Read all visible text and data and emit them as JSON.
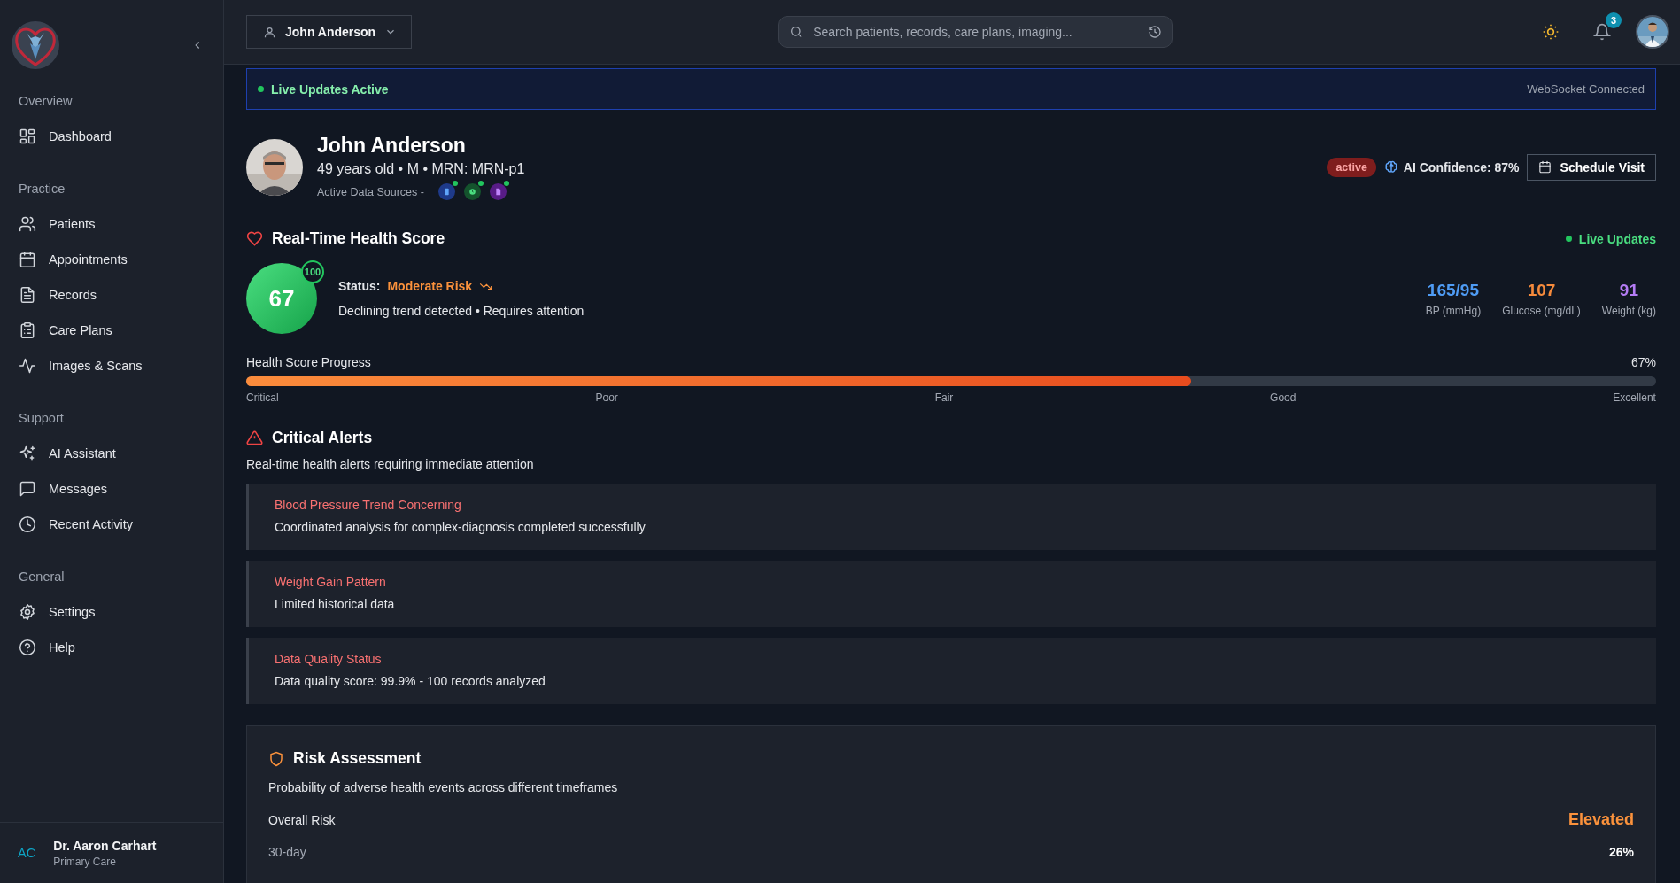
{
  "sidebar": {
    "sections": [
      {
        "title": "Overview",
        "items": [
          {
            "label": "Dashboard",
            "kind": "dashboard"
          }
        ]
      },
      {
        "title": "Practice",
        "items": [
          {
            "label": "Patients",
            "kind": "users"
          },
          {
            "label": "Appointments",
            "kind": "calendar"
          },
          {
            "label": "Records",
            "kind": "file"
          },
          {
            "label": "Care Plans",
            "kind": "clipboard"
          },
          {
            "label": "Images & Scans",
            "kind": "pulse"
          }
        ]
      },
      {
        "title": "Support",
        "items": [
          {
            "label": "AI Assistant",
            "kind": "sparkles"
          },
          {
            "label": "Messages",
            "kind": "message"
          },
          {
            "label": "Recent Activity",
            "kind": "clock"
          }
        ]
      },
      {
        "title": "General",
        "items": [
          {
            "label": "Settings",
            "kind": "gear"
          },
          {
            "label": "Help",
            "kind": "help"
          }
        ]
      }
    ],
    "user": {
      "initials": "AC",
      "name": "Dr. Aaron Carhart",
      "role": "Primary Care"
    }
  },
  "header": {
    "patient_selector": "John Anderson",
    "search": {
      "placeholder": "Search patients, records, care plans, imaging..."
    },
    "notifications": "3"
  },
  "live_banner": {
    "label": "Live Updates Active",
    "status": "WebSocket Connected"
  },
  "patient": {
    "name": "John Anderson",
    "details": "49 years old • M • MRN: MRN-p1",
    "sources_label": "Active Data Sources -",
    "sources": [
      {
        "kind": "device",
        "color": "#1e3a8a"
      },
      {
        "kind": "clock",
        "color": "#14532d"
      },
      {
        "kind": "document",
        "color": "#581c87"
      }
    ],
    "status_badge": "active",
    "ai_confidence": "AI Confidence: 87%",
    "schedule_button": "Schedule Visit"
  },
  "health_score": {
    "title": "Real-Time Health Score",
    "live_label": "Live Updates",
    "score": "67",
    "max": "100",
    "status_label": "Status:",
    "status": "Moderate Risk",
    "note": "Declining trend detected • Requires attention",
    "vitals": [
      {
        "value": "165/95",
        "label": "BP (mmHg)",
        "color": "#4f9cf5"
      },
      {
        "value": "107",
        "label": "Glucose (mg/dL)",
        "color": "#f58a3c"
      },
      {
        "value": "91",
        "label": "Weight (kg)",
        "color": "#b57cf5"
      }
    ],
    "progress": {
      "label": "Health Score Progress",
      "reading": "67%",
      "level": 0.67,
      "ticks": [
        "Critical",
        "Poor",
        "Fair",
        "Good",
        "Excellent"
      ]
    }
  },
  "critical_alerts": {
    "title": "Critical Alerts",
    "subtitle": "Real-time health alerts requiring immediate attention",
    "alerts": [
      {
        "title": "Blood Pressure Trend Concerning",
        "text": "Coordinated analysis for complex-diagnosis completed successfully"
      },
      {
        "title": "Weight Gain Pattern",
        "text": "Limited historical data"
      },
      {
        "title": "Data Quality Status",
        "text": "Data quality score: 99.9% - 100 records analyzed"
      }
    ]
  },
  "risk": {
    "title": "Risk Assessment",
    "subtitle": "Probability of adverse health events across different timeframes",
    "overall_label": "Overall Risk",
    "overall": "Elevated",
    "rows": [
      {
        "period": "30-day",
        "value": "26%"
      }
    ]
  }
}
